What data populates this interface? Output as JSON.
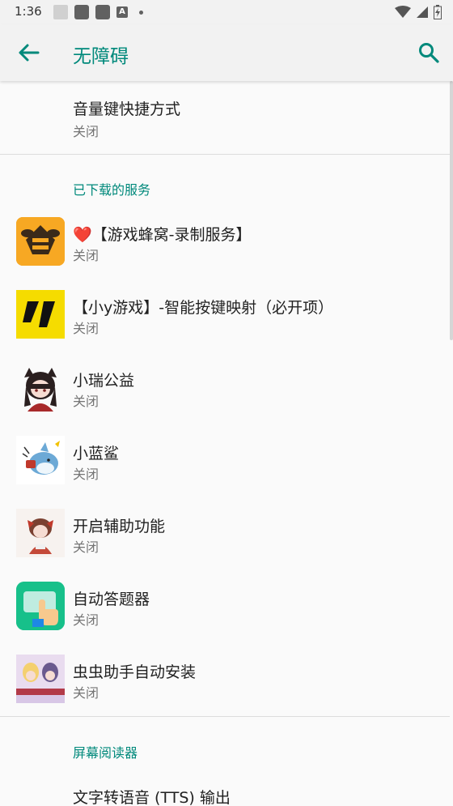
{
  "status_bar": {
    "time": "1:36",
    "notification_badge": "A",
    "icons": [
      "wifi-icon",
      "signal-icon",
      "battery-charging-icon"
    ]
  },
  "app_bar": {
    "title": "无障碍",
    "back_icon": "arrow-back-icon",
    "search_icon": "search-icon"
  },
  "colors": {
    "accent": "#00897b",
    "primary_text": "#212121",
    "secondary_text": "#757575",
    "background": "#fafafa",
    "bar_background": "#f2f2f2"
  },
  "top_item": {
    "title": "音量键快捷方式",
    "summary": "关闭"
  },
  "downloaded_section": {
    "header": "已下载的服务",
    "items": [
      {
        "title": "❤️【游戏蜂窝-录制服务】",
        "summary": "关闭",
        "icon": "bee-app-icon"
      },
      {
        "title": "【小y游戏】-智能按键映射（必开项）",
        "summary": "关闭",
        "icon": "xiaoy-app-icon"
      },
      {
        "title": "小瑞公益",
        "summary": "关闭",
        "icon": "anime-girl-avatar-icon"
      },
      {
        "title": "小蓝鲨",
        "summary": "关闭",
        "icon": "blue-shark-icon"
      },
      {
        "title": "开启辅助功能",
        "summary": "关闭",
        "icon": "chibi-character-icon"
      },
      {
        "title": "自动答题器",
        "summary": "关闭",
        "icon": "tap-hand-icon"
      },
      {
        "title": "虫虫助手自动安装",
        "summary": "关闭",
        "icon": "anime-poster-icon"
      }
    ]
  },
  "screen_reader_section": {
    "header": "屏幕阅读器",
    "items": [
      {
        "title": "文字转语音 (TTS) 输出"
      }
    ]
  }
}
